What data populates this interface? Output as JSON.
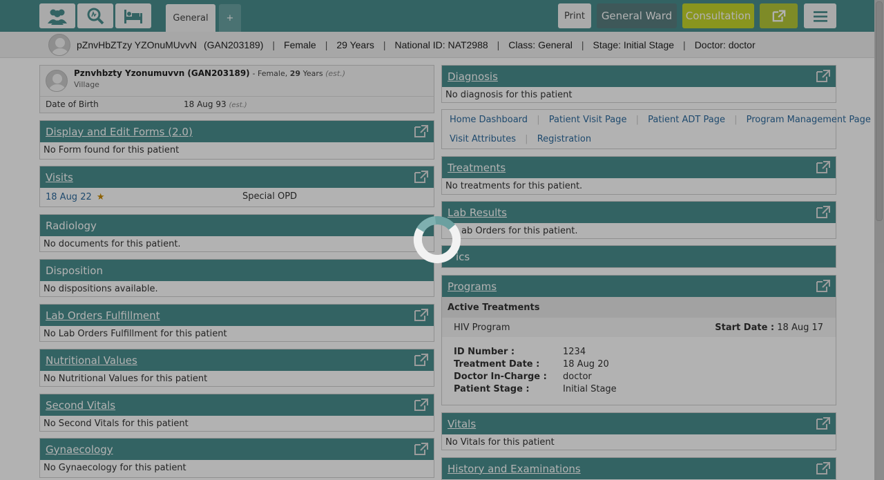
{
  "topbar": {
    "tabs": [
      {
        "label": "General"
      },
      {
        "label": "+"
      }
    ],
    "print_label": "Print",
    "ward_label": "General Ward",
    "consultation_label": "Consultation"
  },
  "patient_bar": {
    "name": "pZnvHbZTzy YZOnuMUvvN",
    "id": "(GAN203189)",
    "gender": "Female",
    "age": "29 Years",
    "national_id": "National ID: NAT2988",
    "class": "Class: General",
    "stage": "Stage: Initial Stage",
    "doctor": "Doctor: doctor"
  },
  "left": {
    "profile": {
      "name": "Pznvhbzty Yzonumuvvn (GAN203189)",
      "gender_text": "Female",
      "age_value": "29",
      "age_unit": "Years",
      "est": "(est.)",
      "village": "Village",
      "dob_label": "Date of Birth",
      "dob_value": "18 Aug 93",
      "dob_est": "(est.)"
    },
    "forms": {
      "title": "Display and Edit Forms (2.0)",
      "body": "No Form found for this patient"
    },
    "visits": {
      "title": "Visits",
      "date": "18 Aug 22",
      "type": "Special OPD"
    },
    "radiology": {
      "title": "Radiology",
      "body": "No documents for this patient."
    },
    "disposition": {
      "title": "Disposition",
      "body": "No dispositions available."
    },
    "lab_fulfillment": {
      "title": "Lab Orders Fulfillment",
      "body": "No Lab Orders Fulfillment for this patient"
    },
    "nutritional": {
      "title": "Nutritional Values",
      "body": "No Nutritional Values for this patient"
    },
    "second_vitals": {
      "title": "Second Vitals",
      "body": "No Second Vitals for this patient"
    },
    "gynaecology": {
      "title": "Gynaecology",
      "body": "No Gynaecology for this patient"
    }
  },
  "right": {
    "diagnosis": {
      "title": "Diagnosis",
      "body": "No diagnosis for this patient"
    },
    "links": [
      "Home Dashboard",
      "Patient Visit Page",
      "Patient ADT Page",
      "Program Management Page",
      "Visit Attributes",
      "Registration"
    ],
    "treatments": {
      "title": "Treatments",
      "body": "No treatments for this patient."
    },
    "lab_results": {
      "title": "Lab Results",
      "body_visible": "ab Orders for this patient."
    },
    "partial": {
      "title": "ics"
    },
    "programs": {
      "title": "Programs",
      "active_label": "Active Treatments",
      "program_name": "HIV Program",
      "start_label": "Start Date :",
      "start_value": "18 Aug 17",
      "rows": [
        {
          "label": "ID Number :",
          "value": "1234"
        },
        {
          "label": "Treatment Date :",
          "value": "18 Aug 20"
        },
        {
          "label": "Doctor In-Charge :",
          "value": "doctor"
        },
        {
          "label": "Patient Stage :",
          "value": "Initial Stage"
        }
      ]
    },
    "vitals": {
      "title": "Vitals",
      "body": "No Vitals for this patient"
    },
    "history": {
      "title": "History and Examinations"
    }
  },
  "colors": {
    "header": "#4a8f8f",
    "consult": "#c5d62b",
    "link": "#2d6b9e"
  }
}
